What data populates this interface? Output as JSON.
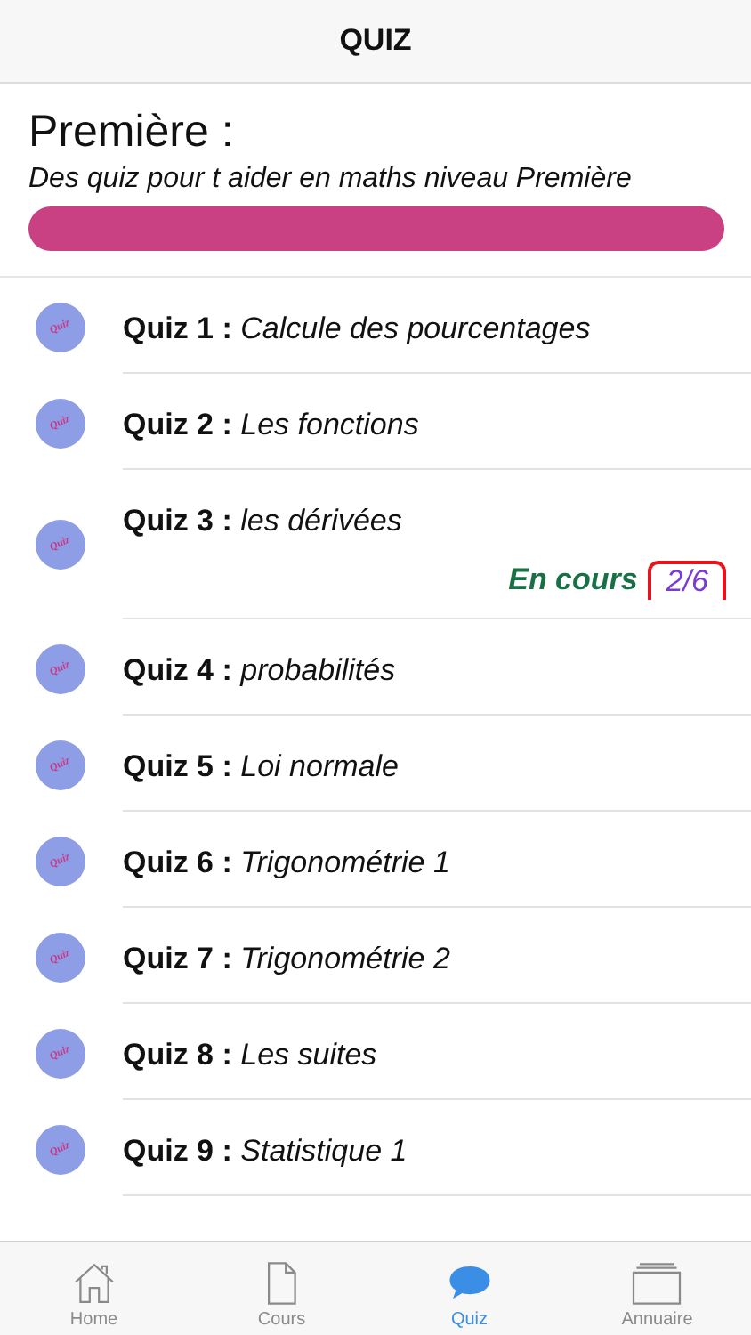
{
  "header": {
    "title": "QUIZ"
  },
  "section": {
    "title": "Première :",
    "subtitle": "Des quiz pour t aider en maths niveau Première"
  },
  "quizzes": [
    {
      "icon_text": "Quiz",
      "label": "Quiz 1 :",
      "title": "Calcule des pourcentages"
    },
    {
      "icon_text": "Quiz",
      "label": "Quiz 2 :",
      "title": "Les fonctions"
    },
    {
      "icon_text": "Quiz",
      "label": "Quiz 3 :",
      "title": "les dérivées",
      "status": {
        "label": "En cours",
        "progress": "2/6"
      }
    },
    {
      "icon_text": "Quiz",
      "label": "Quiz 4 :",
      "title": "probabilités"
    },
    {
      "icon_text": "Quiz",
      "label": "Quiz 5 :",
      "title": "Loi normale"
    },
    {
      "icon_text": "Quiz",
      "label": "Quiz 6 :",
      "title": "Trigonométrie 1"
    },
    {
      "icon_text": "Quiz",
      "label": "Quiz 7 :",
      "title": "Trigonométrie 2"
    },
    {
      "icon_text": "Quiz",
      "label": "Quiz 8 :",
      "title": "Les suites"
    },
    {
      "icon_text": "Quiz",
      "label": "Quiz 9 :",
      "title": "Statistique 1"
    }
  ],
  "tabs": [
    {
      "kind": "home",
      "label": "Home",
      "selected": false
    },
    {
      "kind": "courses",
      "label": "Cours",
      "selected": false
    },
    {
      "kind": "quiz",
      "label": "Quiz",
      "selected": true
    },
    {
      "kind": "directory",
      "label": "Annuaire",
      "selected": false
    }
  ]
}
